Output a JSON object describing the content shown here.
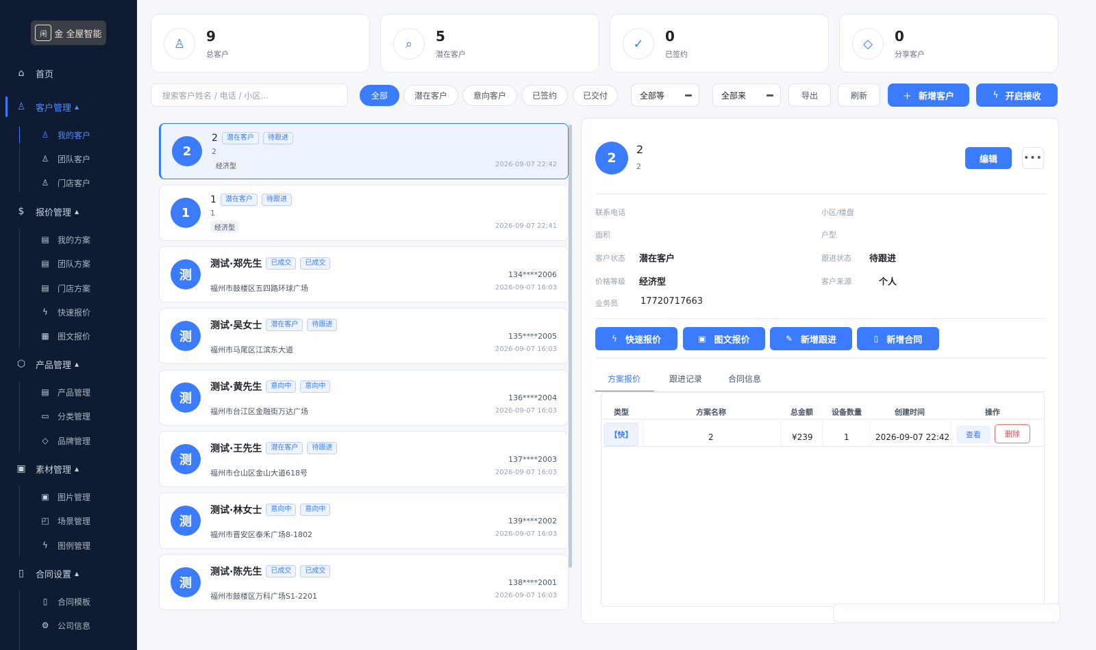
{
  "brand": {
    "logo_seal": "闲",
    "logo_text": "金 全屋智能"
  },
  "sidebar": {
    "items": [
      {
        "label": "首页",
        "icon": "home-icon",
        "glyph": "⌂"
      },
      {
        "label": "客户管理",
        "icon": "user-icon",
        "glyph": "♙",
        "caret": "▲"
      },
      {
        "label": "我的客户",
        "icon": "user-icon",
        "glyph": "♙"
      },
      {
        "label": "团队客户",
        "icon": "user-icon",
        "glyph": "♙"
      },
      {
        "label": "门店客户",
        "icon": "user-icon",
        "glyph": "♙"
      },
      {
        "label": "报价管理",
        "icon": "dollar-circle-icon",
        "glyph": "$",
        "caret": "▲"
      },
      {
        "label": "我的方案",
        "icon": "documents-icon",
        "glyph": "▤"
      },
      {
        "label": "团队方案",
        "icon": "documents-icon",
        "glyph": "▤"
      },
      {
        "label": "门店方案",
        "icon": "documents-icon",
        "glyph": "▤"
      },
      {
        "label": "快速报价",
        "icon": "lightning-icon",
        "glyph": "ϟ"
      },
      {
        "label": "图文报价",
        "icon": "image-text-icon",
        "glyph": "▦"
      },
      {
        "label": "产品管理",
        "icon": "box-icon",
        "glyph": "⬡",
        "caret": "▲"
      },
      {
        "label": "产品管理",
        "icon": "documents-icon",
        "glyph": "▤"
      },
      {
        "label": "分类管理",
        "icon": "folder-icon",
        "glyph": "▭"
      },
      {
        "label": "品牌管理",
        "icon": "tag-icon",
        "glyph": "◇"
      },
      {
        "label": "素材管理",
        "icon": "image-icon",
        "glyph": "▣",
        "caret": "▲"
      },
      {
        "label": "图片管理",
        "icon": "image-icon",
        "glyph": "▣"
      },
      {
        "label": "场景管理",
        "icon": "scene-icon",
        "glyph": "◰"
      },
      {
        "label": "图例管理",
        "icon": "lightning-icon",
        "glyph": "ϟ"
      },
      {
        "label": "合同设置",
        "icon": "document-icon",
        "glyph": "▯",
        "caret": "▲"
      },
      {
        "label": "合同模板",
        "icon": "document-icon",
        "glyph": "▯"
      },
      {
        "label": "公司信息",
        "icon": "gear-icon",
        "glyph": "⚙"
      }
    ]
  },
  "stats": [
    {
      "value": "9",
      "label": "总客户",
      "icon": "user-icon",
      "glyph": "♙"
    },
    {
      "value": "5",
      "label": "潜在客户",
      "icon": "search-icon",
      "glyph": "⌕"
    },
    {
      "value": "0",
      "label": "已签约",
      "icon": "check-circle-icon",
      "glyph": "✓"
    },
    {
      "value": "0",
      "label": "分享客户",
      "icon": "tag-icon",
      "glyph": "◇"
    }
  ],
  "toolbar": {
    "search_placeholder": "搜索客户姓名 / 电话 / 小区...",
    "filters": [
      "全部",
      "潜在客户",
      "意向客户",
      "已签约",
      "已交付"
    ],
    "level_select": "全部等",
    "source_select": "全部来",
    "export_label": "导出",
    "refresh_label": "刷新",
    "add_label": "新增客户",
    "receive_label": "开启接收"
  },
  "customers": [
    {
      "avatar": "2",
      "name": "2",
      "tags": [
        "潜在客户",
        "待跟进"
      ],
      "line2": "2",
      "type": "经济型",
      "phone": "",
      "time": "2026-09-07 22:42"
    },
    {
      "avatar": "1",
      "name": "1",
      "tags": [
        "潜在客户",
        "待跟进"
      ],
      "line2": "1",
      "type": "经济型",
      "phone": "",
      "time": "2026-09-07 22:41"
    },
    {
      "avatar": "测",
      "name": "测试·郑先生",
      "tags": [
        "已成交",
        "已成交"
      ],
      "address": "福州市鼓楼区五四路环球广场",
      "phone": "134****2006",
      "time": "2026-09-07 16:03"
    },
    {
      "avatar": "测",
      "name": "测试·吴女士",
      "tags": [
        "潜在客户",
        "待跟进"
      ],
      "address": "福州市马尾区江滨东大道",
      "phone": "135****2005",
      "time": "2026-09-07 16:03"
    },
    {
      "avatar": "测",
      "name": "测试·黄先生",
      "tags": [
        "意向中",
        "意向中"
      ],
      "address": "福州市台江区金融街万达广场",
      "phone": "136****2004",
      "time": "2026-09-07 16:03"
    },
    {
      "avatar": "测",
      "name": "测试·王先生",
      "tags": [
        "潜在客户",
        "待跟进"
      ],
      "address": "福州市仓山区金山大道618号",
      "phone": "137****2003",
      "time": "2026-09-07 16:03"
    },
    {
      "avatar": "测",
      "name": "测试·林女士",
      "tags": [
        "意向中",
        "意向中"
      ],
      "address": "福州市晋安区泰禾广场8-1802",
      "phone": "139****2002",
      "time": "2026-09-07 16:03"
    },
    {
      "avatar": "测",
      "name": "测试·陈先生",
      "tags": [
        "已成交",
        "已成交"
      ],
      "address": "福州市鼓楼区万科广场S1-2201",
      "phone": "138****2001",
      "time": "2026-09-07 16:03"
    }
  ],
  "detail": {
    "avatar": "2",
    "name": "2",
    "sub": "2",
    "edit_label": "编辑",
    "more_label": "•••",
    "fields": {
      "phone_label": "联系电话",
      "phone_value": "",
      "community_label": "小区/楼盘",
      "community_value": "",
      "area_label": "面积",
      "area_value": "",
      "layout_label": "户型",
      "layout_value": "",
      "status_label": "客户状态",
      "status_value": "潜在客户",
      "follow_label": "跟进状态",
      "follow_value": "待跟进",
      "level_label": "价格等级",
      "level_value": "经济型",
      "source_label": "客户来源",
      "source_value": "个人",
      "sales_label": "业务员",
      "sales_value": "17720717663"
    },
    "actions": [
      {
        "label": "快速报价",
        "icon": "lightning-icon",
        "glyph": "ϟ"
      },
      {
        "label": "图文报价",
        "icon": "image-icon",
        "glyph": "▣"
      },
      {
        "label": "新增跟进",
        "icon": "edit-icon",
        "glyph": "✎"
      },
      {
        "label": "新增合同",
        "icon": "document-icon",
        "glyph": "▯"
      }
    ],
    "tabs": [
      "方案报价",
      "跟进记录",
      "合同信息"
    ],
    "table": {
      "headers": [
        "类型",
        "方案名称",
        "总金额",
        "设备数量",
        "创建时间",
        "操作"
      ],
      "rows": [
        {
          "type": "【快】",
          "name": "2",
          "amount": "¥239",
          "count": "1",
          "created": "2026-09-07 22:42",
          "view": "查看",
          "delete": "删除"
        }
      ]
    }
  }
}
